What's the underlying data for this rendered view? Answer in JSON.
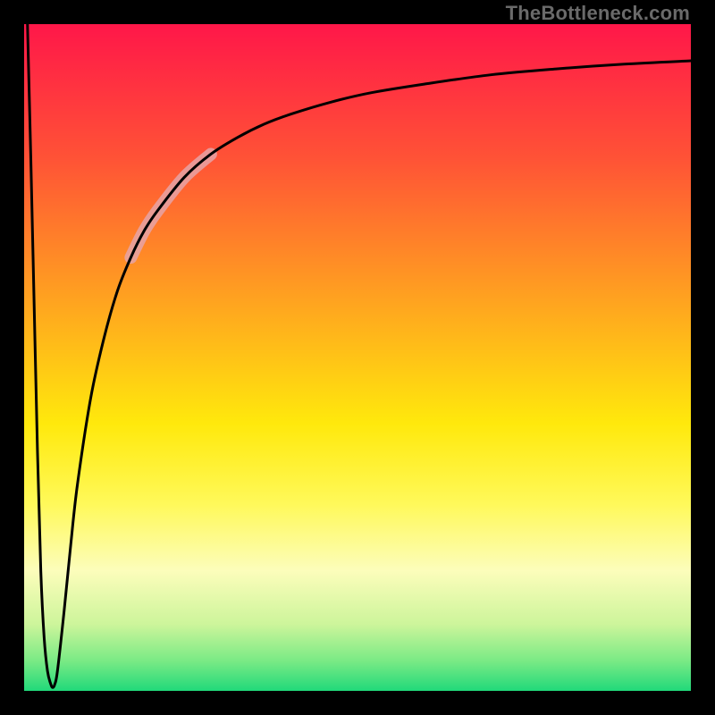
{
  "watermark": {
    "text": "TheBottleneck.com"
  },
  "gradient": {
    "stops": [
      {
        "offset": 0.0,
        "color": "#ff1749"
      },
      {
        "offset": 0.2,
        "color": "#ff5236"
      },
      {
        "offset": 0.42,
        "color": "#ffa51f"
      },
      {
        "offset": 0.6,
        "color": "#ffe90c"
      },
      {
        "offset": 0.72,
        "color": "#fff95a"
      },
      {
        "offset": 0.82,
        "color": "#fcfdbb"
      },
      {
        "offset": 0.9,
        "color": "#cdf59b"
      },
      {
        "offset": 0.955,
        "color": "#7aea85"
      },
      {
        "offset": 1.0,
        "color": "#21d97a"
      }
    ]
  },
  "chart_data": {
    "type": "line",
    "title": "",
    "xlabel": "",
    "ylabel": "",
    "xlim": [
      0,
      100
    ],
    "ylim": [
      0,
      100
    ],
    "grid": false,
    "legend": false,
    "series": [
      {
        "name": "curve",
        "x": [
          0.5,
          1.0,
          1.5,
          2.0,
          2.5,
          3.0,
          3.5,
          4.0,
          4.3,
          4.6,
          5.0,
          6.0,
          7.0,
          8.0,
          10.0,
          12.0,
          14.0,
          16.0,
          18.0,
          20.0,
          24.0,
          28.0,
          32.0,
          36.0,
          40.0,
          46.0,
          52.0,
          60.0,
          70.0,
          80.0,
          90.0,
          100.0
        ],
        "y": [
          100.0,
          80.0,
          58.0,
          36.0,
          18.0,
          8.0,
          3.0,
          1.0,
          0.5,
          1.0,
          3.0,
          12.0,
          22.0,
          31.0,
          44.0,
          53.0,
          60.0,
          65.0,
          69.0,
          72.0,
          77.0,
          80.5,
          83.0,
          85.0,
          86.5,
          88.3,
          89.7,
          91.0,
          92.4,
          93.3,
          94.0,
          94.5
        ]
      }
    ],
    "highlight_band": {
      "series": "curve",
      "x_start": 18.0,
      "x_end": 28.0
    }
  }
}
